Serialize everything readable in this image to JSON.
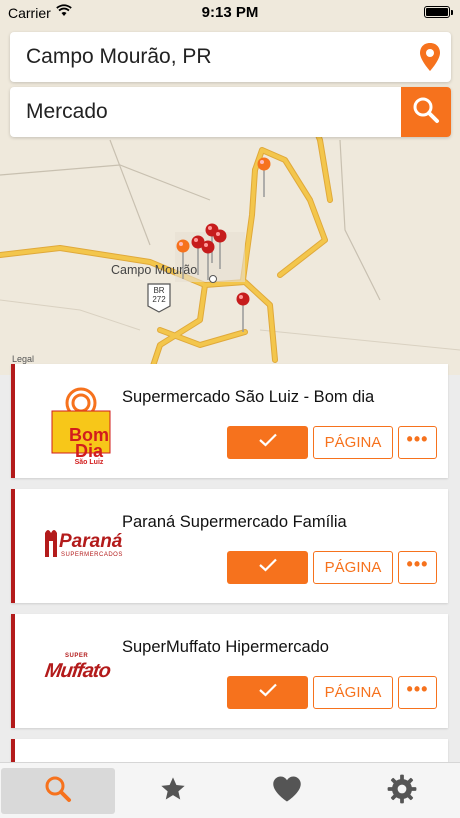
{
  "status_bar": {
    "carrier": "Carrier",
    "time": "9:13 PM"
  },
  "location": {
    "value": "Campo Mourão, PR",
    "icon": "map-pin-icon"
  },
  "search": {
    "value": "Mercado",
    "icon": "search-icon"
  },
  "map": {
    "city_label": "Campo Mourão",
    "highway_label": "BR\n272",
    "legal": "Legal"
  },
  "stores": [
    {
      "name": "Supermercado São Luiz - Bom dia",
      "logo_text": [
        "Bom",
        "Dia",
        "São Luiz"
      ],
      "page_label": "PÁGINA",
      "more_label": "•••"
    },
    {
      "name": "Paraná Supermercado Família",
      "logo_text": [
        "Paraná",
        "SUPERMERCADOS"
      ],
      "page_label": "PÁGINA",
      "more_label": "•••"
    },
    {
      "name": "SuperMuffato Hipermercado",
      "logo_text": [
        "SUPER",
        "Muffato"
      ],
      "page_label": "PÁGINA",
      "more_label": "•••"
    }
  ],
  "tabs": [
    {
      "icon": "search-icon",
      "active": true
    },
    {
      "icon": "star-icon",
      "active": false
    },
    {
      "icon": "heart-icon",
      "active": false
    },
    {
      "icon": "gear-icon",
      "active": false
    }
  ],
  "colors": {
    "accent": "#f6721d",
    "card_border": "#b31b1b",
    "road": "#f3c64c"
  }
}
